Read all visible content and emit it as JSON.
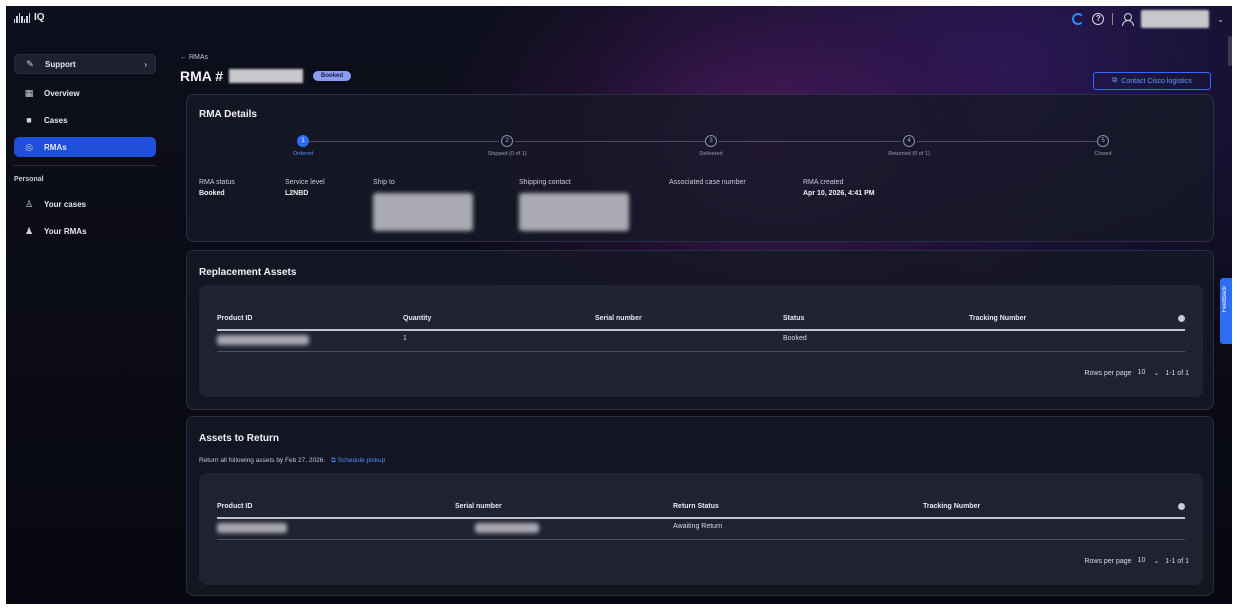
{
  "app": {
    "logo_text": "IQ"
  },
  "sidebar": {
    "support_label": "Support",
    "items": [
      {
        "label": "Overview",
        "icon": "grid-icon"
      },
      {
        "label": "Cases",
        "icon": "briefcase-icon"
      },
      {
        "label": "RMAs",
        "icon": "rma-icon"
      }
    ],
    "personal_label": "Personal",
    "personal_items": [
      {
        "label": "Your cases",
        "icon": "user-cases-icon"
      },
      {
        "label": "Your RMAs",
        "icon": "user-rmas-icon"
      }
    ]
  },
  "header": {
    "back_label": "← RMAs",
    "title_prefix": "RMA #",
    "status_badge": "Booked",
    "contact_button": "Contact Cisco logistics"
  },
  "details": {
    "title": "RMA Details",
    "steps": [
      {
        "num": "1",
        "label": "Ordered",
        "done": true
      },
      {
        "num": "2",
        "label": "Shipped (0 of 1)",
        "done": false
      },
      {
        "num": "3",
        "label": "Delivered",
        "done": false
      },
      {
        "num": "4",
        "label": "Returned (0 of 1)",
        "done": false
      },
      {
        "num": "5",
        "label": "Closed",
        "done": false
      }
    ],
    "fields": {
      "status_label": "RMA status",
      "status_value": "Booked",
      "service_label": "Service level",
      "service_value": "L2NBD",
      "ship_to_label": "Ship to",
      "contact_label": "Shipping contact",
      "case_label": "Associated case number",
      "created_label": "RMA created",
      "created_value": "Apr 10, 2026, 4:41 PM"
    }
  },
  "replacement": {
    "title": "Replacement Assets",
    "columns": [
      "Product ID",
      "Quantity",
      "Serial number",
      "Status",
      "Tracking Number"
    ],
    "row": {
      "quantity": "1",
      "status": "Booked"
    },
    "pager": {
      "label": "Rows per page",
      "value": "10",
      "range": "1-1 of 1"
    }
  },
  "returns": {
    "title": "Assets to Return",
    "note": "Return all following assets by Feb 27, 2026.",
    "schedule_link": "Schedule pickup",
    "columns": [
      "Product ID",
      "Serial number",
      "Return Status",
      "Tracking Number"
    ],
    "row": {
      "return_status": "Awaiting Return"
    },
    "pager": {
      "label": "Rows per page",
      "value": "10",
      "range": "1-1 of 1"
    }
  },
  "feedback_label": "Feedback",
  "colors": {
    "accent": "#2f6cf5",
    "link": "#4f8fff",
    "badge": "#8b9cf0"
  }
}
